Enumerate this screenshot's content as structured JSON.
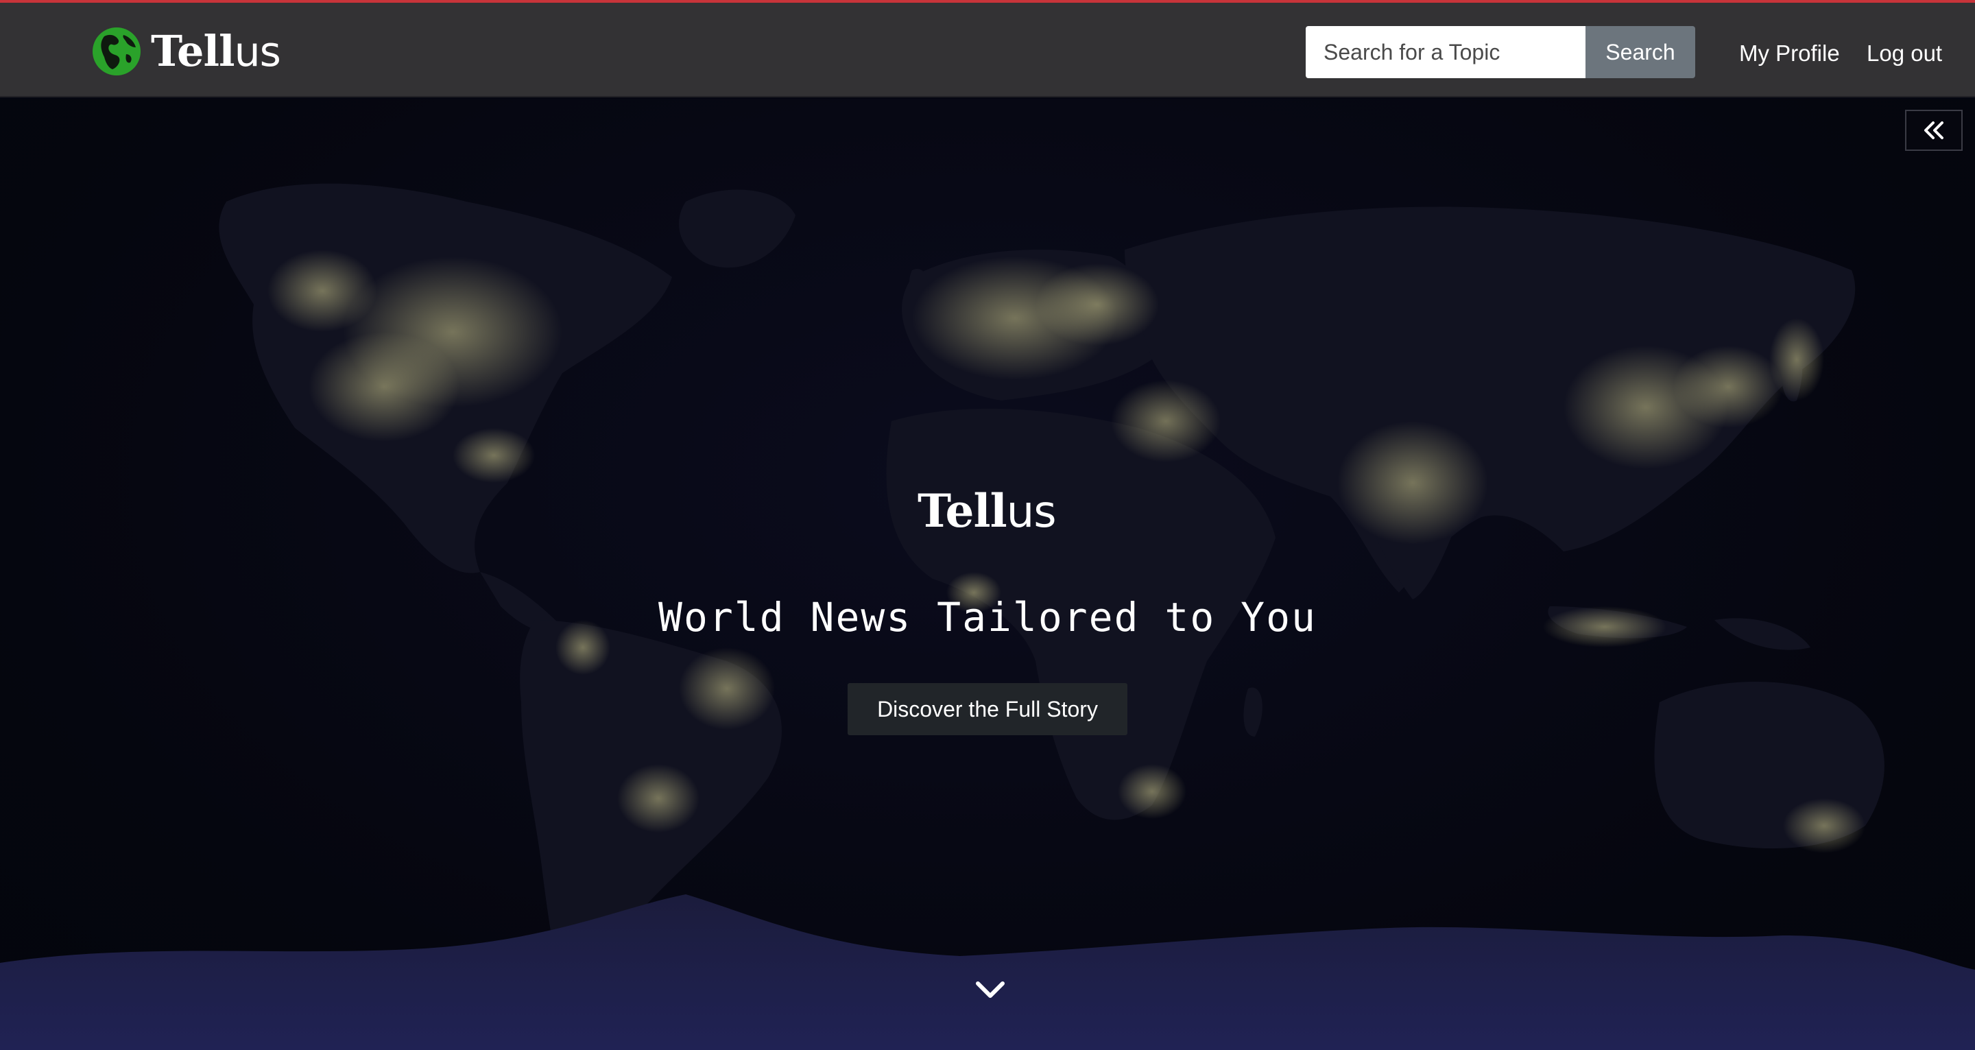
{
  "header": {
    "brand": {
      "bold": "Tell",
      "thin": "us",
      "icon": "globe-icon",
      "icon_color": "#2aa22a"
    },
    "search": {
      "placeholder": "Search for a Topic",
      "button_label": "Search"
    },
    "nav": {
      "profile": "My Profile",
      "logout": "Log out"
    },
    "accent_line_color": "#c8343a",
    "bg_color": "#333234"
  },
  "hero": {
    "background": "world-at-night-map",
    "logo": {
      "bold": "Tell",
      "thin": "us"
    },
    "tagline": "World News Tailored to You",
    "cta_label": "Discover the Full Story",
    "collapse_icon": "double-chevron-left-icon",
    "scroll_icon": "chevron-down-icon"
  }
}
